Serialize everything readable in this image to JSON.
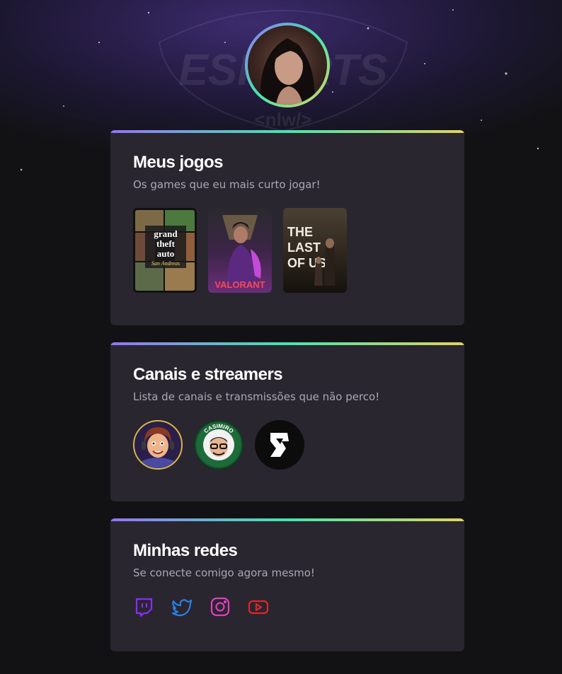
{
  "profile": {
    "avatar_icon": "profile-photo"
  },
  "background": {
    "watermark_text": "ESPORTS",
    "watermark_sub": "<nlw/>"
  },
  "sections": [
    {
      "id": "games",
      "title": "Meus jogos",
      "subtitle": "Os games que eu mais curto jogar!",
      "items": [
        {
          "name": "Grand Theft Auto San Andreas",
          "label_top": "grand",
          "label_mid": "theft",
          "label_bot": "auto",
          "label_sub": "San Andreas"
        },
        {
          "name": "Valorant",
          "label": "VALORANT"
        },
        {
          "name": "The Last of Us",
          "line1": "THE",
          "line2": "LAST",
          "line3": "OF US"
        }
      ]
    },
    {
      "id": "channels",
      "title": "Canais e streamers",
      "subtitle": "Lista de canais e transmissões que não perco!",
      "items": [
        {
          "name": "streamer-1"
        },
        {
          "name": "casimiro",
          "ring_text": "CASIMIRO"
        },
        {
          "name": "streamer-3"
        }
      ]
    },
    {
      "id": "socials",
      "title": "Minhas redes",
      "subtitle": "Se conecte comigo agora mesmo!",
      "items": [
        {
          "name": "twitch",
          "icon": "twitch-icon",
          "color": "#8b2cf5"
        },
        {
          "name": "twitter",
          "icon": "twitter-icon",
          "color": "#2a7fe8"
        },
        {
          "name": "instagram",
          "icon": "instagram-icon",
          "color": "#e13fbf"
        },
        {
          "name": "youtube",
          "icon": "youtube-icon",
          "color": "#e3252c"
        }
      ]
    }
  ],
  "colors": {
    "gradient_start": "#9572fc",
    "gradient_mid": "#43e7ad",
    "gradient_end": "#e2d45c",
    "card_bg": "#29262f",
    "page_bg": "#121214",
    "subtitle": "#a8a8b3"
  }
}
